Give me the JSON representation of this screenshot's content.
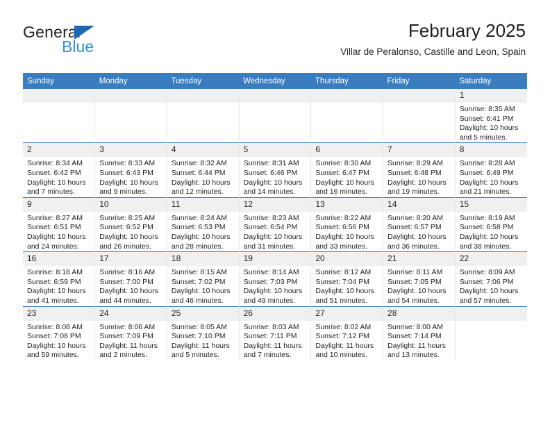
{
  "brand": {
    "name_top": "General",
    "name_bottom": "Blue",
    "triangle_color": "#1b69b2",
    "blue_color": "#2e8fd6"
  },
  "header": {
    "title": "February 2025",
    "subtitle": "Villar de Peralonso, Castille and Leon, Spain"
  },
  "theme": {
    "header_row_bg": "#3a7dbf",
    "daynum_bg": "#f0f0f0",
    "grid_line": "#3a7dbf",
    "text": "#231f20"
  },
  "labels": {
    "sunrise_prefix": "Sunrise:",
    "sunset_prefix": "Sunset:",
    "daylight_prefix": "Daylight:"
  },
  "weekdays": [
    "Sunday",
    "Monday",
    "Tuesday",
    "Wednesday",
    "Thursday",
    "Friday",
    "Saturday"
  ],
  "weeks": [
    [
      {
        "empty": true
      },
      {
        "empty": true
      },
      {
        "empty": true
      },
      {
        "empty": true
      },
      {
        "empty": true
      },
      {
        "empty": true
      },
      {
        "day": "1",
        "sunrise": "Sunrise: 8:35 AM",
        "sunset": "Sunset: 6:41 PM",
        "daylight": "Daylight: 10 hours and 5 minutes."
      }
    ],
    [
      {
        "day": "2",
        "sunrise": "Sunrise: 8:34 AM",
        "sunset": "Sunset: 6:42 PM",
        "daylight": "Daylight: 10 hours and 7 minutes."
      },
      {
        "day": "3",
        "sunrise": "Sunrise: 8:33 AM",
        "sunset": "Sunset: 6:43 PM",
        "daylight": "Daylight: 10 hours and 9 minutes."
      },
      {
        "day": "4",
        "sunrise": "Sunrise: 8:32 AM",
        "sunset": "Sunset: 6:44 PM",
        "daylight": "Daylight: 10 hours and 12 minutes."
      },
      {
        "day": "5",
        "sunrise": "Sunrise: 8:31 AM",
        "sunset": "Sunset: 6:46 PM",
        "daylight": "Daylight: 10 hours and 14 minutes."
      },
      {
        "day": "6",
        "sunrise": "Sunrise: 8:30 AM",
        "sunset": "Sunset: 6:47 PM",
        "daylight": "Daylight: 10 hours and 16 minutes."
      },
      {
        "day": "7",
        "sunrise": "Sunrise: 8:29 AM",
        "sunset": "Sunset: 6:48 PM",
        "daylight": "Daylight: 10 hours and 19 minutes."
      },
      {
        "day": "8",
        "sunrise": "Sunrise: 8:28 AM",
        "sunset": "Sunset: 6:49 PM",
        "daylight": "Daylight: 10 hours and 21 minutes."
      }
    ],
    [
      {
        "day": "9",
        "sunrise": "Sunrise: 8:27 AM",
        "sunset": "Sunset: 6:51 PM",
        "daylight": "Daylight: 10 hours and 24 minutes."
      },
      {
        "day": "10",
        "sunrise": "Sunrise: 8:25 AM",
        "sunset": "Sunset: 6:52 PM",
        "daylight": "Daylight: 10 hours and 26 minutes."
      },
      {
        "day": "11",
        "sunrise": "Sunrise: 8:24 AM",
        "sunset": "Sunset: 6:53 PM",
        "daylight": "Daylight: 10 hours and 28 minutes."
      },
      {
        "day": "12",
        "sunrise": "Sunrise: 8:23 AM",
        "sunset": "Sunset: 6:54 PM",
        "daylight": "Daylight: 10 hours and 31 minutes."
      },
      {
        "day": "13",
        "sunrise": "Sunrise: 8:22 AM",
        "sunset": "Sunset: 6:56 PM",
        "daylight": "Daylight: 10 hours and 33 minutes."
      },
      {
        "day": "14",
        "sunrise": "Sunrise: 8:20 AM",
        "sunset": "Sunset: 6:57 PM",
        "daylight": "Daylight: 10 hours and 36 minutes."
      },
      {
        "day": "15",
        "sunrise": "Sunrise: 8:19 AM",
        "sunset": "Sunset: 6:58 PM",
        "daylight": "Daylight: 10 hours and 38 minutes."
      }
    ],
    [
      {
        "day": "16",
        "sunrise": "Sunrise: 8:18 AM",
        "sunset": "Sunset: 6:59 PM",
        "daylight": "Daylight: 10 hours and 41 minutes."
      },
      {
        "day": "17",
        "sunrise": "Sunrise: 8:16 AM",
        "sunset": "Sunset: 7:00 PM",
        "daylight": "Daylight: 10 hours and 44 minutes."
      },
      {
        "day": "18",
        "sunrise": "Sunrise: 8:15 AM",
        "sunset": "Sunset: 7:02 PM",
        "daylight": "Daylight: 10 hours and 46 minutes."
      },
      {
        "day": "19",
        "sunrise": "Sunrise: 8:14 AM",
        "sunset": "Sunset: 7:03 PM",
        "daylight": "Daylight: 10 hours and 49 minutes."
      },
      {
        "day": "20",
        "sunrise": "Sunrise: 8:12 AM",
        "sunset": "Sunset: 7:04 PM",
        "daylight": "Daylight: 10 hours and 51 minutes."
      },
      {
        "day": "21",
        "sunrise": "Sunrise: 8:11 AM",
        "sunset": "Sunset: 7:05 PM",
        "daylight": "Daylight: 10 hours and 54 minutes."
      },
      {
        "day": "22",
        "sunrise": "Sunrise: 8:09 AM",
        "sunset": "Sunset: 7:06 PM",
        "daylight": "Daylight: 10 hours and 57 minutes."
      }
    ],
    [
      {
        "day": "23",
        "sunrise": "Sunrise: 8:08 AM",
        "sunset": "Sunset: 7:08 PM",
        "daylight": "Daylight: 10 hours and 59 minutes."
      },
      {
        "day": "24",
        "sunrise": "Sunrise: 8:06 AM",
        "sunset": "Sunset: 7:09 PM",
        "daylight": "Daylight: 11 hours and 2 minutes."
      },
      {
        "day": "25",
        "sunrise": "Sunrise: 8:05 AM",
        "sunset": "Sunset: 7:10 PM",
        "daylight": "Daylight: 11 hours and 5 minutes."
      },
      {
        "day": "26",
        "sunrise": "Sunrise: 8:03 AM",
        "sunset": "Sunset: 7:11 PM",
        "daylight": "Daylight: 11 hours and 7 minutes."
      },
      {
        "day": "27",
        "sunrise": "Sunrise: 8:02 AM",
        "sunset": "Sunset: 7:12 PM",
        "daylight": "Daylight: 11 hours and 10 minutes."
      },
      {
        "day": "28",
        "sunrise": "Sunrise: 8:00 AM",
        "sunset": "Sunset: 7:14 PM",
        "daylight": "Daylight: 11 hours and 13 minutes."
      },
      {
        "empty": true
      }
    ]
  ]
}
